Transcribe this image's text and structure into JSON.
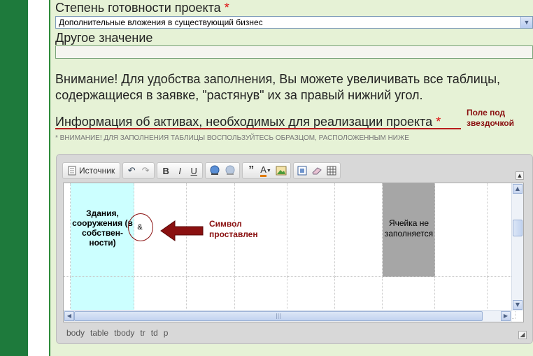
{
  "form": {
    "stage_label": "Степень готовности проекта",
    "required_mark": "*",
    "stage_value": "Дополнительные вложения в существующий бизнес",
    "other_label": "Другое значение",
    "other_value": "",
    "notice": "Внимание! Для удобства заполнения, Вы можете увеличивать все таблицы, содержащиеся в заявке, \"растянув\" их за правый нижний угол.",
    "section_title": "Информация об активах, необходимых для реализации проекта",
    "section_hint": "* ВНИМАНИЕ! ДЛЯ ЗАПОЛНЕНИЯ ТАБЛИЦЫ ВОСПОЛЬЗУЙТЕСЬ ОБРАЗЦОМ, РАСПОЛОЖЕННЫМ НИЖЕ"
  },
  "annotations": {
    "field_hint": "Поле под звездочкой",
    "symbol_note": "Символ проставлен"
  },
  "editor": {
    "source_label": "Источник",
    "bold_label": "B",
    "italic_label": "I",
    "underline_label": "U",
    "quote_label": "”",
    "font_color_label": "A",
    "cells": {
      "buildings": "Здания, сооружения (в собствен-ности)",
      "ampersand": "&",
      "not_filled": "Ячейка не заполняется"
    },
    "path": [
      "body",
      "table",
      "tbody",
      "tr",
      "td",
      "p"
    ]
  },
  "colors": {
    "sidebar_green": "#1e7a3c",
    "panel_bg": "#e6f2d6",
    "required_red": "#d11111",
    "annotation_red": "#8a1010",
    "cyan_cell": "#ccffff",
    "gray_cell": "#a6a6a6"
  }
}
